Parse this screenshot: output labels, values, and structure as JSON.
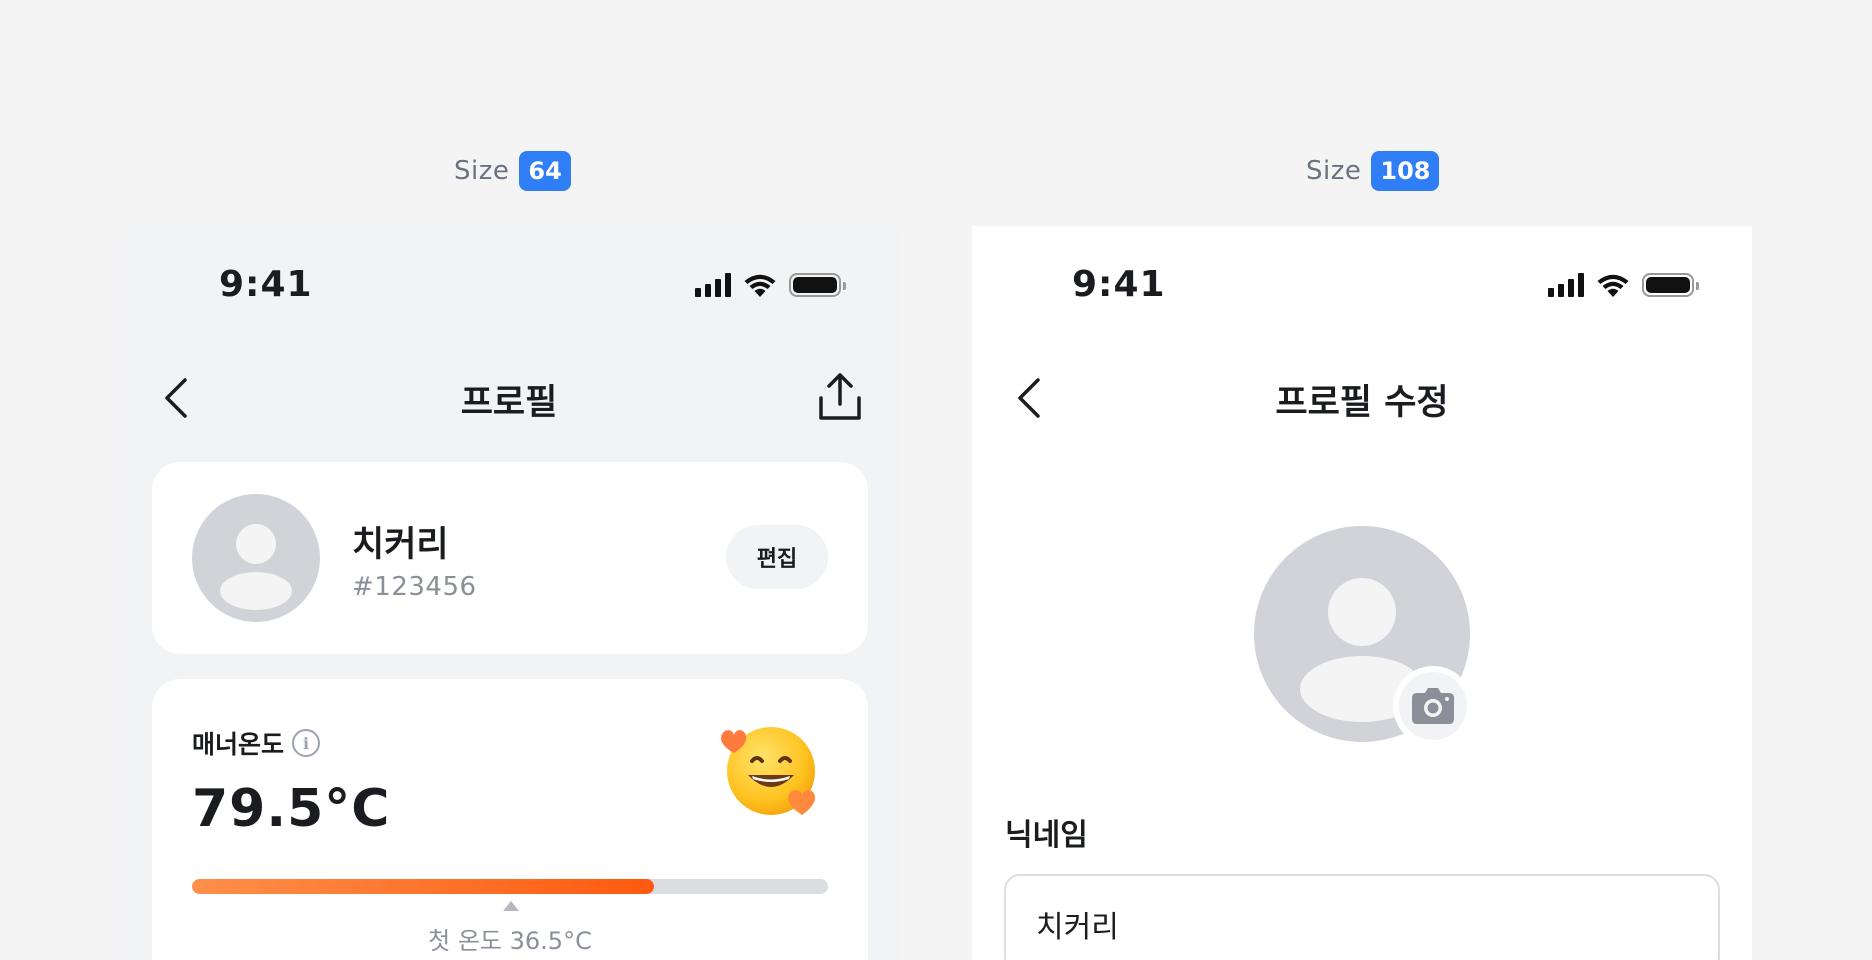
{
  "size_labels": [
    {
      "text": "Size",
      "value": "64"
    },
    {
      "text": "Size",
      "value": "108"
    }
  ],
  "profile_screen": {
    "status_time": "9:41",
    "title": "프로필",
    "user": {
      "name": "치커리",
      "id": "#123456"
    },
    "edit_label": "편집",
    "manner": {
      "label": "매너온도",
      "temperature": "79.5°C",
      "progress_fraction": 0.727,
      "first_temp_label": "첫 온도 36.5°C",
      "emoji": "smiling-face-with-hearts"
    }
  },
  "edit_screen": {
    "status_time": "9:41",
    "title": "프로필 수정",
    "nickname_label": "닉네임",
    "nickname_value": "치커리"
  },
  "colors": {
    "badge": "#2f7ef5",
    "accent_orange": "#ff5a0f",
    "background": "#f4f4f5"
  }
}
